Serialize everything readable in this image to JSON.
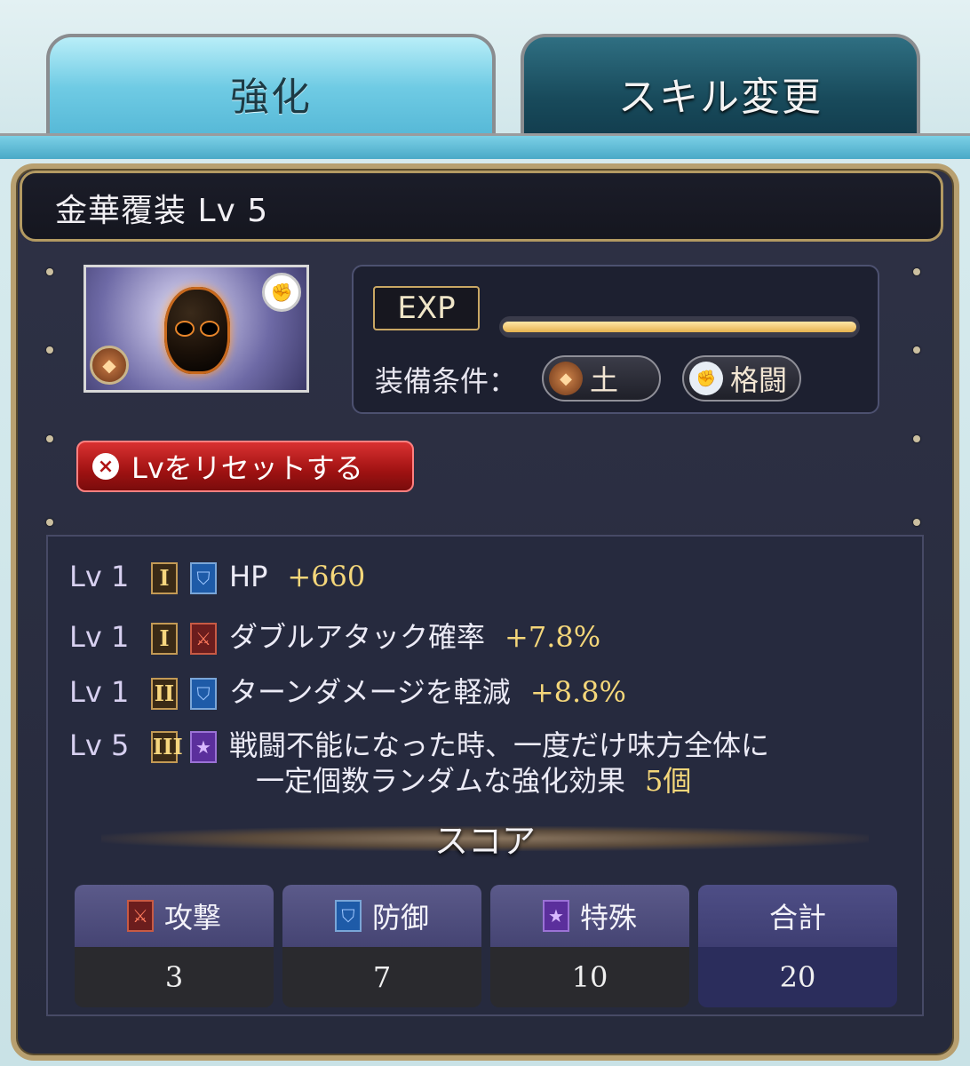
{
  "tabs": {
    "enhance": "強化",
    "skill_change": "スキル変更"
  },
  "item": {
    "title": "金華覆装 Lv 5"
  },
  "exp": {
    "label": "EXP",
    "progress": 1.0
  },
  "equip": {
    "condition_label": "装備条件：",
    "element": {
      "icon": "earth-element-icon",
      "label": "土"
    },
    "weapon": {
      "icon": "gauntlet-icon",
      "label": "格闘"
    }
  },
  "reset_button": "Lvをリセットする",
  "skills": [
    {
      "lv": "Lv 1",
      "rank": "I",
      "type": "defense",
      "name": "HP",
      "value": "+660"
    },
    {
      "lv": "Lv 1",
      "rank": "I",
      "type": "attack",
      "name": "ダブルアタック確率",
      "value": "+7.8%"
    },
    {
      "lv": "Lv 1",
      "rank": "II",
      "type": "defense",
      "name": "ターンダメージを軽減",
      "value": "+8.8%"
    },
    {
      "lv": "Lv 5",
      "rank": "III",
      "type": "special",
      "name_line1": "戦闘不能になった時、一度だけ味方全体に",
      "name_line2": "一定個数ランダムな強化効果",
      "value": "5個"
    }
  ],
  "score": {
    "title": "スコア",
    "attack": {
      "label": "攻撃",
      "value": "3"
    },
    "defense": {
      "label": "防御",
      "value": "7"
    },
    "special": {
      "label": "特殊",
      "value": "10"
    },
    "total": {
      "label": "合計",
      "value": "20"
    }
  },
  "colors": {
    "accent_gold": "#b8a070",
    "value_yellow": "#f5d77a",
    "reset_red": "#c41f1f"
  }
}
